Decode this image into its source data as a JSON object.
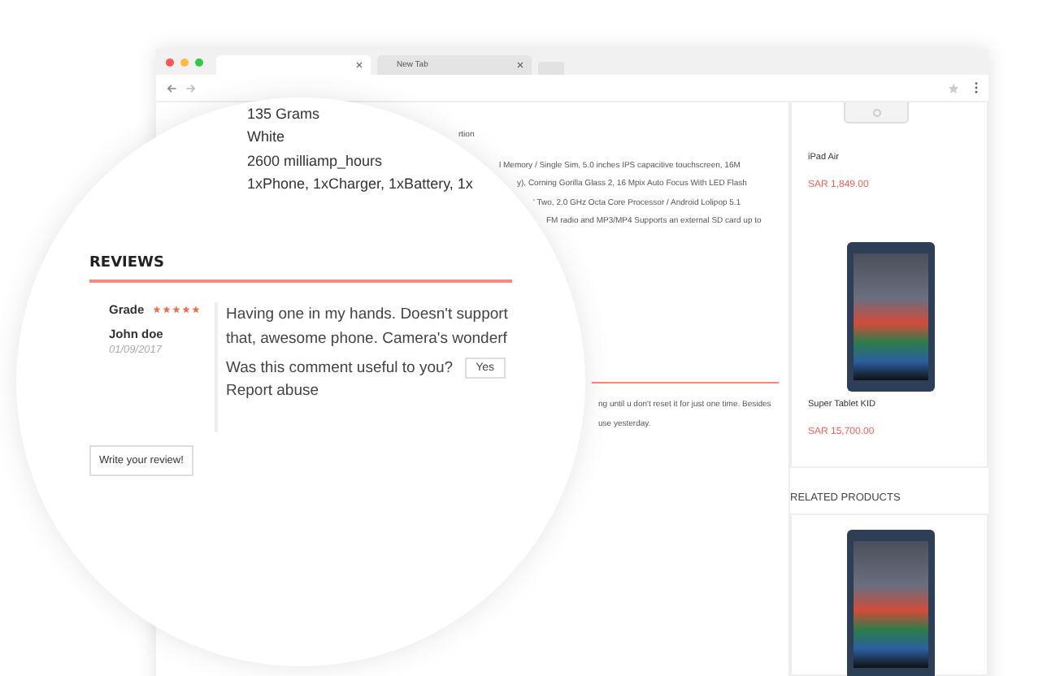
{
  "browser": {
    "tabs": [
      {
        "selected": true
      },
      {
        "label": "New Tab",
        "selected": false
      }
    ]
  },
  "page": {
    "description_fragments": [
      "rtion",
      "l Memory / Single Sim, 5.0 inches IPS capacitive touchscreen, 16M",
      "y), Corning Gorilla Glass 2, 16 Mpix Auto Focus With LED Flash",
      "' Two, 2.0 GHz Octa Core Processor / Android Lolipop 5.1",
      "FM radio and MP3/MP4 Supports an external SD card up to"
    ],
    "review_fragments": [
      "ng until u don't reset it for just one time. Besides",
      "use yesterday."
    ]
  },
  "sidebar": {
    "products": [
      {
        "kind": "ipad",
        "name": "iPad Air",
        "price": "SAR 1,849.00"
      },
      {
        "kind": "tablet",
        "name": "Super Tablet KID",
        "price": "SAR 15,700.00"
      }
    ],
    "related_title": "RELATED PRODUCTS",
    "related": [
      {
        "kind": "tablet"
      }
    ]
  },
  "magnifier": {
    "specs": [
      "135 Grams",
      "White",
      "2600 milliamp_hours",
      "1xPhone, 1xCharger, 1xBattery, 1x"
    ],
    "reviews_title": "REVIEWS",
    "review": {
      "grade_label": "Grade",
      "stars": 5,
      "author": "John doe",
      "date": "01/09/2017",
      "text_lines": [
        "Having one in my hands. Doesn't support",
        "that, awesome phone. Camera's wonderf"
      ],
      "question": "Was this comment useful to you?",
      "yes": "Yes",
      "report": "Report abuse"
    },
    "write_button": "Write your review!"
  }
}
